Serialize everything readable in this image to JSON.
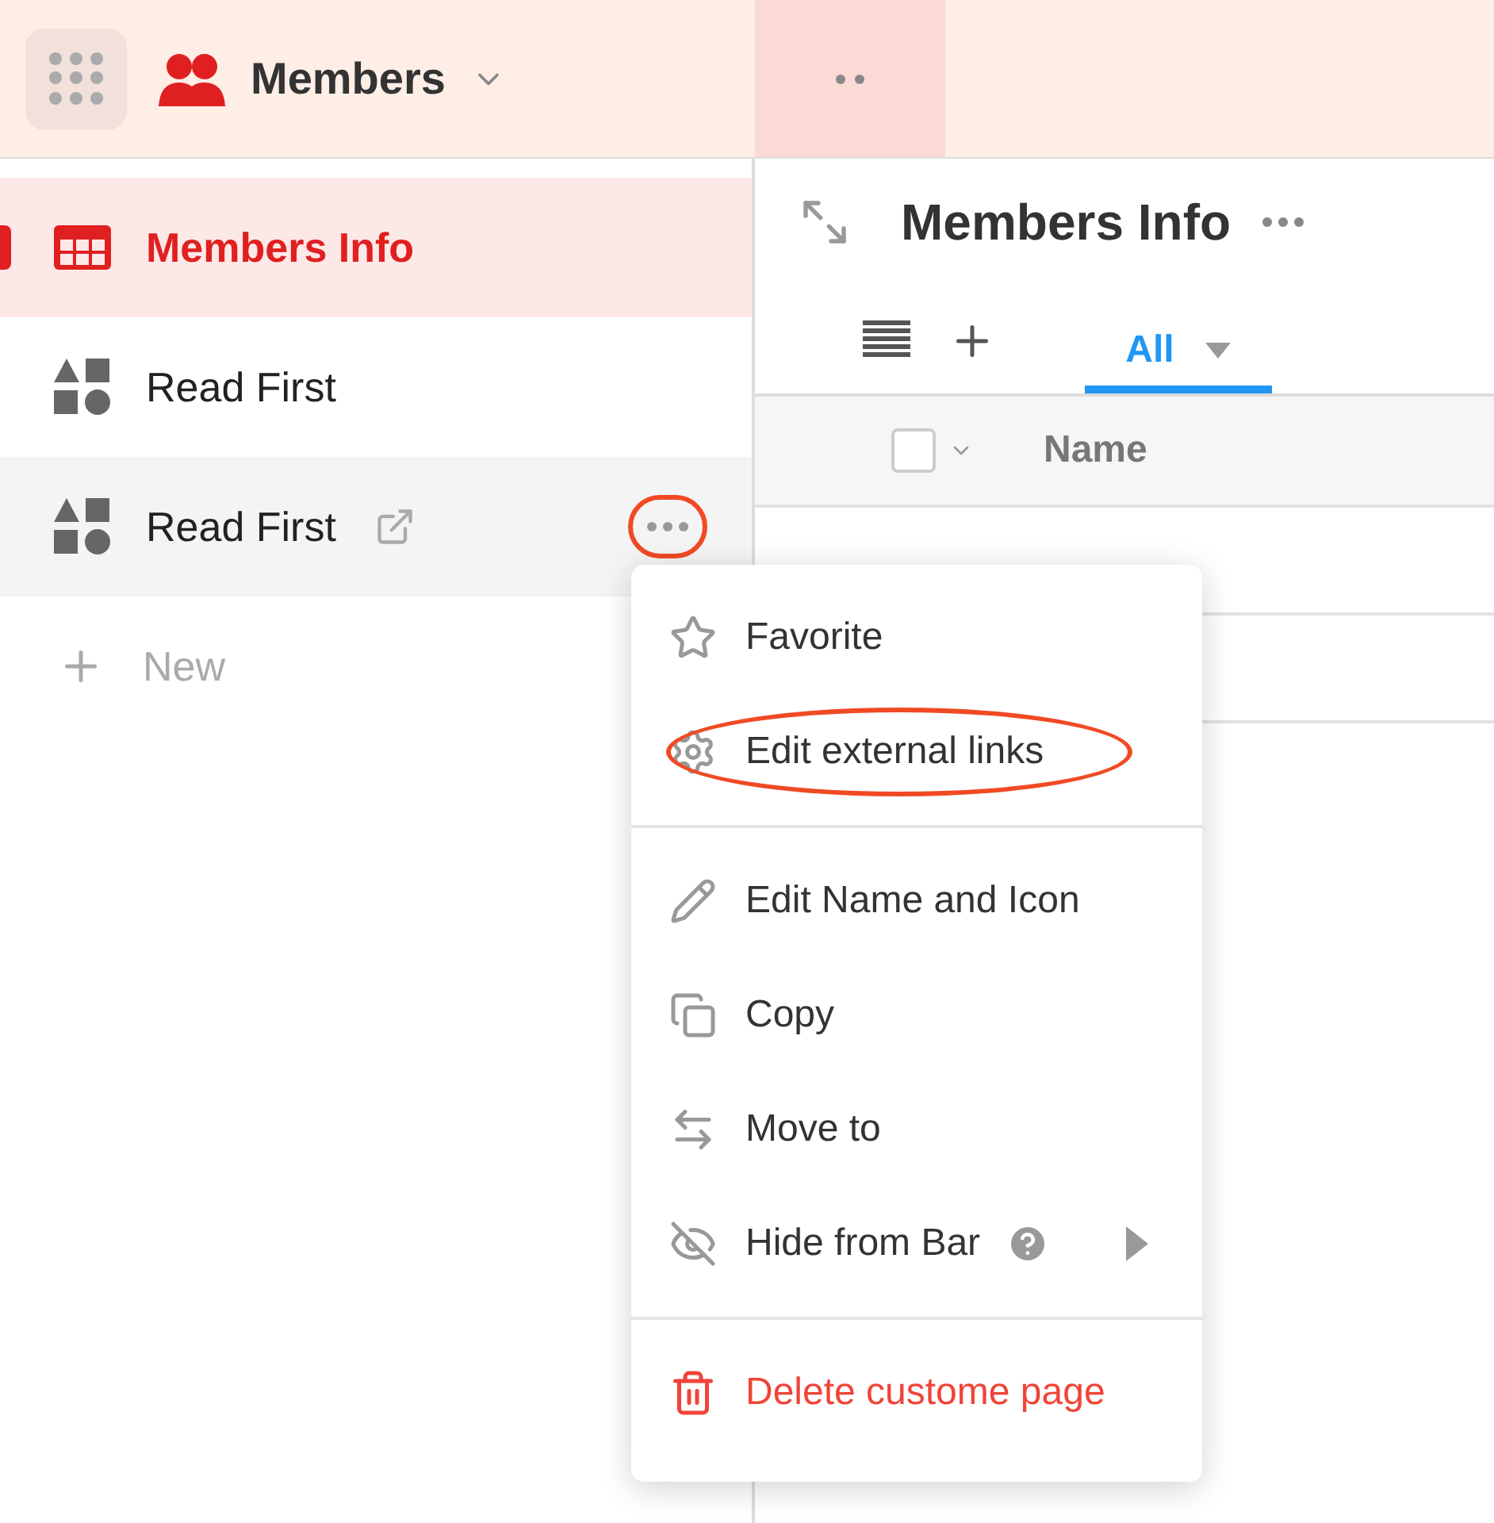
{
  "app": {
    "title": "Members"
  },
  "sidebar": {
    "items": [
      {
        "label": "Members Info",
        "kind": "table",
        "selected": true,
        "hovered": false,
        "external": false,
        "annotated": false
      },
      {
        "label": "Read First",
        "kind": "page",
        "selected": false,
        "hovered": false,
        "external": false,
        "annotated": false
      },
      {
        "label": "Read First",
        "kind": "page",
        "selected": false,
        "hovered": true,
        "external": true,
        "annotated": true
      }
    ],
    "new_label": "New"
  },
  "view": {
    "title": "Members Info",
    "tabs": [
      {
        "label": "All",
        "selected": true
      }
    ],
    "select_all": {
      "checked": false
    },
    "columns": [
      "Name"
    ]
  },
  "menu": {
    "sections": [
      [
        {
          "label": "Favorite",
          "kind": "normal",
          "annotated": false
        },
        {
          "label": "Edit external links",
          "kind": "normal",
          "annotated": true
        }
      ],
      [
        {
          "label": "Edit Name and Icon",
          "kind": "normal",
          "annotated": false
        },
        {
          "label": "Copy",
          "kind": "normal",
          "annotated": false
        },
        {
          "label": "Move to",
          "kind": "normal",
          "annotated": false
        },
        {
          "label": "Hide from Bar",
          "kind": "submenu",
          "annotated": false
        }
      ],
      [
        {
          "label": "Delete custome page",
          "kind": "danger",
          "annotated": false
        }
      ]
    ]
  }
}
